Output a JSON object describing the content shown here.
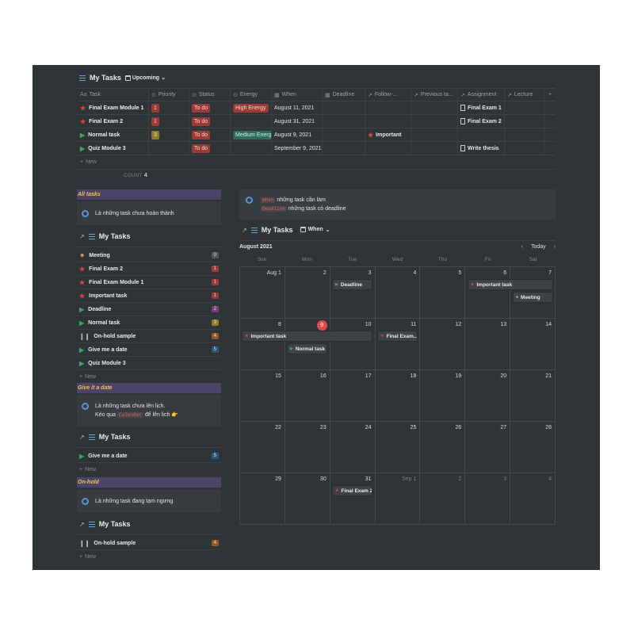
{
  "table_view": {
    "db_name": "My Tasks",
    "view_name": "Upcoming",
    "columns": [
      "Task",
      "Priority",
      "Status",
      "Energy",
      "When",
      "Deadline",
      "Follow-...",
      "Previous ta...",
      "Assignment",
      "Lecture",
      "+"
    ],
    "rows": [
      {
        "icon": "star-icon",
        "task": "Final Exam Module 1",
        "priority": "1",
        "status": "To do",
        "energy": "High Energy",
        "when": "August 11, 2021",
        "deadline": "",
        "follow": "",
        "previous": "",
        "assignment": "Final Exam 1",
        "lecture": ""
      },
      {
        "icon": "star-icon",
        "task": "Final Exam 2",
        "priority": "1",
        "status": "To do",
        "energy": "",
        "when": "August 31, 2021",
        "deadline": "",
        "follow": "",
        "previous": "",
        "assignment": "Final Exam 2",
        "lecture": ""
      },
      {
        "icon": "play-icon",
        "task": "Normal task",
        "priority": "3",
        "status": "To do",
        "energy": "Medium Energy",
        "when": "August 9, 2021",
        "deadline": "",
        "follow": "Important",
        "previous": "",
        "assignment": "",
        "lecture": ""
      },
      {
        "icon": "play-icon",
        "task": "Quiz Module 3",
        "priority": "",
        "status": "To do",
        "energy": "",
        "when": "September 9, 2021",
        "deadline": "",
        "follow": "",
        "previous": "",
        "assignment": "Write thesis",
        "lecture": ""
      }
    ],
    "new_label": "New",
    "count_label": "COUNT",
    "count_value": "4"
  },
  "all_tasks": {
    "title": "All tasks",
    "callout": "Là những task chưa hoàn thành",
    "db_name": "My Tasks",
    "items": [
      {
        "icon": "meeting-icon",
        "label": "Meeting",
        "badge": "0",
        "badge_color": "gray"
      },
      {
        "icon": "star-icon",
        "label": "Final Exam 2",
        "badge": "1",
        "badge_color": "red"
      },
      {
        "icon": "star-icon",
        "label": "Final Exam Module 1",
        "badge": "1",
        "badge_color": "red"
      },
      {
        "icon": "star-icon",
        "label": "Important task",
        "badge": "1",
        "badge_color": "red"
      },
      {
        "icon": "play-icon",
        "label": "Deadline",
        "badge": "2",
        "badge_color": "purple"
      },
      {
        "icon": "play-icon",
        "label": "Normal task",
        "badge": "3",
        "badge_color": "yellow"
      },
      {
        "icon": "pause-icon",
        "label": "On-hold sample",
        "badge": "4",
        "badge_color": "orange"
      },
      {
        "icon": "play-icon",
        "label": "Give me a date",
        "badge": "5",
        "badge_color": "blue"
      },
      {
        "icon": "play-icon",
        "label": "Quiz Module 3",
        "badge": "",
        "badge_color": ""
      }
    ],
    "new_label": "New"
  },
  "give_date": {
    "title": "Give it a date",
    "callout_line1": "Là những task chưa lên lịch.",
    "callout_line2_prefix": "Kéo qua",
    "callout_code": "Calender",
    "callout_line2_suffix": "để lên lịch 👉",
    "db_name": "My Tasks",
    "items": [
      {
        "icon": "play-icon",
        "label": "Give me a date",
        "badge": "5",
        "badge_color": "blue"
      }
    ],
    "new_label": "New"
  },
  "on_hold": {
    "title": "On-hold",
    "callout": "Là những task đang tạm ngưng",
    "db_name": "My Tasks",
    "items": [
      {
        "icon": "pause-icon",
        "label": "On-hold sample",
        "badge": "4",
        "badge_color": "orange"
      }
    ],
    "new_label": "New"
  },
  "right_callout": {
    "code1": "When",
    "text1": "những task cần làm",
    "code2": "Deadline",
    "text2": "những task có deadline"
  },
  "calendar": {
    "db_name": "My Tasks",
    "view_name": "When",
    "month": "August 2021",
    "today_label": "Today",
    "weekdays": [
      "Sun",
      "Mon",
      "Tue",
      "Wed",
      "Thu",
      "Fri",
      "Sat"
    ],
    "weeks": [
      [
        {
          "d": "Aug 1"
        },
        {
          "d": "2"
        },
        {
          "d": "3"
        },
        {
          "d": "4"
        },
        {
          "d": "5"
        },
        {
          "d": "6"
        },
        {
          "d": "7"
        }
      ],
      [
        {
          "d": "8"
        },
        {
          "d": "9",
          "today": true
        },
        {
          "d": "10"
        },
        {
          "d": "11"
        },
        {
          "d": "12"
        },
        {
          "d": "13"
        },
        {
          "d": "14"
        }
      ],
      [
        {
          "d": "15"
        },
        {
          "d": "16"
        },
        {
          "d": "17"
        },
        {
          "d": "18"
        },
        {
          "d": "19"
        },
        {
          "d": "20"
        },
        {
          "d": "21"
        }
      ],
      [
        {
          "d": "22"
        },
        {
          "d": "23"
        },
        {
          "d": "24"
        },
        {
          "d": "25"
        },
        {
          "d": "26"
        },
        {
          "d": "27"
        },
        {
          "d": "28"
        }
      ],
      [
        {
          "d": "29"
        },
        {
          "d": "30"
        },
        {
          "d": "31"
        },
        {
          "d": "Sep 1",
          "dim": true
        },
        {
          "d": "2",
          "dim": true
        },
        {
          "d": "3",
          "dim": true
        },
        {
          "d": "4",
          "dim": true
        }
      ]
    ],
    "events": [
      {
        "label": "Deadline",
        "date": "2021-08-03",
        "span_days": 1,
        "marker": "green"
      },
      {
        "label": "Important task",
        "date": "2021-08-06",
        "span_days": 2,
        "marker": "red"
      },
      {
        "label": "Meeting",
        "date": "2021-08-07",
        "span_days": 1,
        "marker": "gray"
      },
      {
        "label": "Important task",
        "date": "2021-08-08",
        "span_days": 3,
        "marker": "red"
      },
      {
        "label": "Final Exam...",
        "date": "2021-08-11",
        "span_days": 1,
        "marker": "red"
      },
      {
        "label": "Normal task",
        "date": "2021-08-09",
        "span_days": 1,
        "marker": "green"
      },
      {
        "label": "Final Exam 2",
        "date": "2021-08-31",
        "span_days": 1,
        "marker": "red"
      }
    ]
  }
}
